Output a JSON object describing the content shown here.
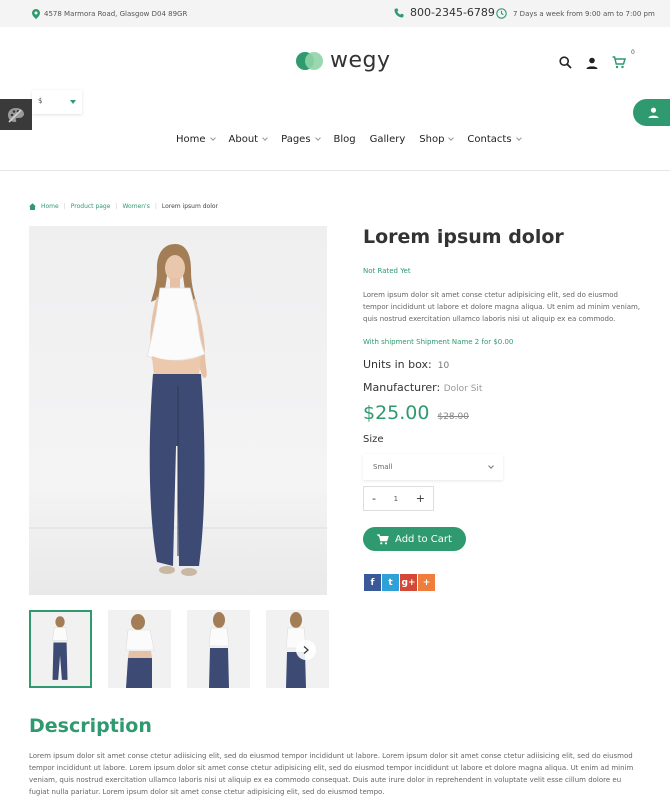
{
  "topbar": {
    "address": "4578 Marmora Road, Glasgow D04 89GR",
    "phone": "800-2345-6789",
    "hours": "7 Days a week from 9:00 am to 7:00 pm"
  },
  "brand": {
    "name": "wegy",
    "accent": "#2f9a6f"
  },
  "header": {
    "cart_count": "0"
  },
  "currency": {
    "selected": "$"
  },
  "nav": {
    "items": [
      {
        "label": "Home",
        "dropdown": true
      },
      {
        "label": "About",
        "dropdown": true
      },
      {
        "label": "Pages",
        "dropdown": true
      },
      {
        "label": "Blog",
        "dropdown": false
      },
      {
        "label": "Gallery",
        "dropdown": false
      },
      {
        "label": "Shop",
        "dropdown": true
      },
      {
        "label": "Contacts",
        "dropdown": true
      }
    ]
  },
  "breadcrumb": {
    "home": "Home",
    "product_page": "Product page",
    "womens": "Women's",
    "current": "Lorem ipsum dolor"
  },
  "product": {
    "title": "Lorem ipsum dolor",
    "rating": "Not Rated Yet",
    "description": "Lorem ipsum dolor sit amet conse ctetur adipisicing elit, sed do eiusmod tempor incididunt ut labore et dolore magna aliqua. Ut enim ad minim veniam, quis nostrud exercitation ullamco laboris nisi ut aliquip ex ea commodo.",
    "shipment": "With shipment Shipment Name 2 for $0.00",
    "units_label": "Units in box:",
    "units_value": "10",
    "manufacturer_label": "Manufacturer:",
    "manufacturer_value": "Dolor Sit",
    "price": "$25.00",
    "old_price": "$28.00",
    "size_label": "Size",
    "size_selected": "Small",
    "qty_minus": "-",
    "qty_value": "1",
    "qty_plus": "+",
    "add_to_cart": "Add to Cart"
  },
  "share": {
    "items": [
      {
        "icon": "facebook-icon",
        "glyph": "f",
        "color": "#3b5998"
      },
      {
        "icon": "twitter-icon",
        "glyph": "t",
        "color": "#2da1d8"
      },
      {
        "icon": "google-plus-icon",
        "glyph": "g+",
        "color": "#d34836"
      },
      {
        "icon": "more-share-icon",
        "glyph": "+",
        "color": "#ef7d3c"
      }
    ]
  },
  "description_section": {
    "heading": "Description",
    "body": "Lorem ipsum dolor sit amet conse ctetur adiisicing elit, sed do eiusmod tempor incididunt ut labore. Lorem ipsum dolor sit amet conse ctetur adiisicing elit, sed do eiusmod tempor incididunt ut labore. Lorem ipsum dolor sit amet conse ctetur adipisicing elit, sed do eiusmod tempor incididunt ut labore et dolore magna aliqua. Ut enim ad minim veniam, quis nostrud exercitation ullamco laboris nisi ut aliquip ex ea commodo consequat. Duis aute irure dolor in reprehendent in voluptate velit esse cillum dolore eu fugiat nulla pariatur. Lorem ipsum dolor sit amet conse ctetur adipisicing elit, sed do eiusmod tempo."
  }
}
